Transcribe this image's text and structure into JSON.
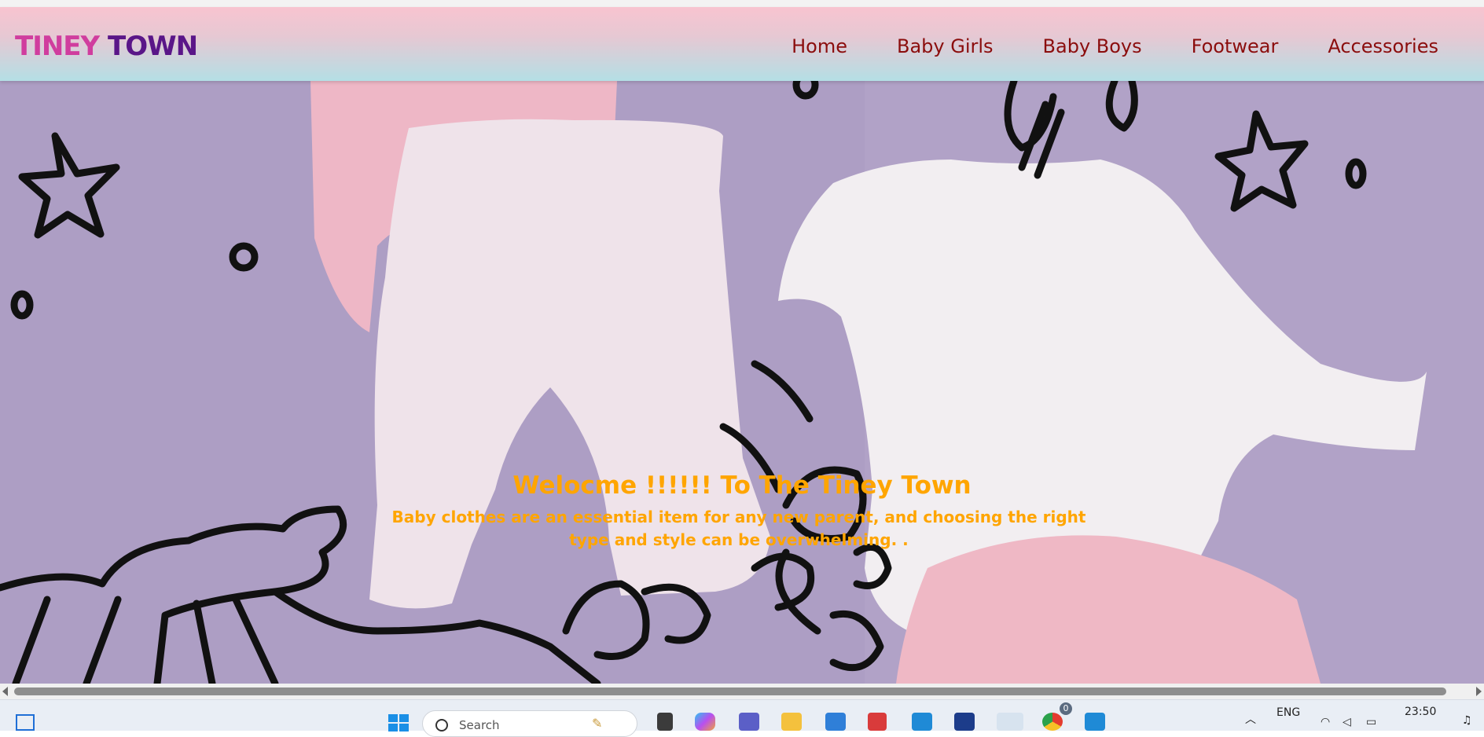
{
  "site": {
    "logo": {
      "part1": "TINEY",
      "part2": "TOWN"
    },
    "nav": [
      {
        "label": "Home"
      },
      {
        "label": "Baby Girls"
      },
      {
        "label": "Baby Boys"
      },
      {
        "label": "Footwear"
      },
      {
        "label": "Accessories"
      }
    ],
    "hero": {
      "title": "Welocme !!!!!! To The Tiney Town",
      "subtitle": "Baby clothes are an essential item for any new parent, and choosing the right type and style can be overwhelming. ."
    }
  },
  "taskbar": {
    "search_placeholder": "Search",
    "icons": [
      "windows-start-icon",
      "task-view-icon",
      "copilot-icon",
      "teams-icon",
      "file-explorer-icon",
      "store-icon",
      "gmail-icon",
      "app-blue-icon",
      "app-navy-icon",
      "edge-icon",
      "chrome-icon",
      "vscode-icon"
    ],
    "chrome_badge": "0",
    "language": "ENG",
    "time": "23:50"
  },
  "colors": {
    "nav_text": "#8b0d0d",
    "hero_text": "#ffa500",
    "hero_bg": "#ad9ec4",
    "navbar_top": "#f8c4d0",
    "navbar_bottom": "#b4dfe5"
  }
}
